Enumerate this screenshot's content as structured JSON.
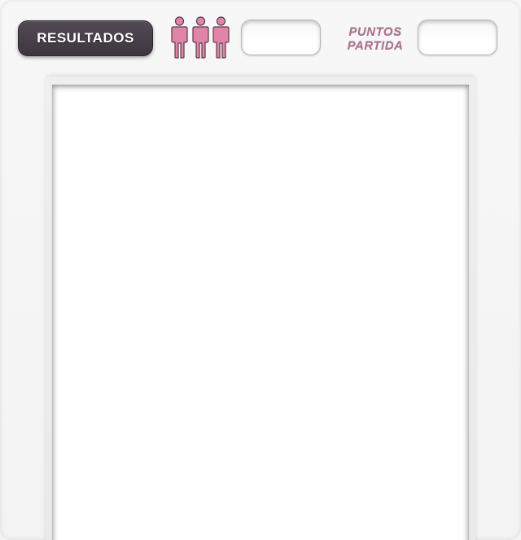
{
  "header": {
    "results_label": "RESULTADOS",
    "players_icon": "three-people-icon",
    "players_value": "",
    "points_label_line1": "PUNTOS",
    "points_label_line2": "PARTIDA",
    "points_value": ""
  },
  "colors": {
    "results_button": "#463f48",
    "person_icon": "#e085a8",
    "points_label": "#b06f8f",
    "panel": "#ffffff"
  }
}
